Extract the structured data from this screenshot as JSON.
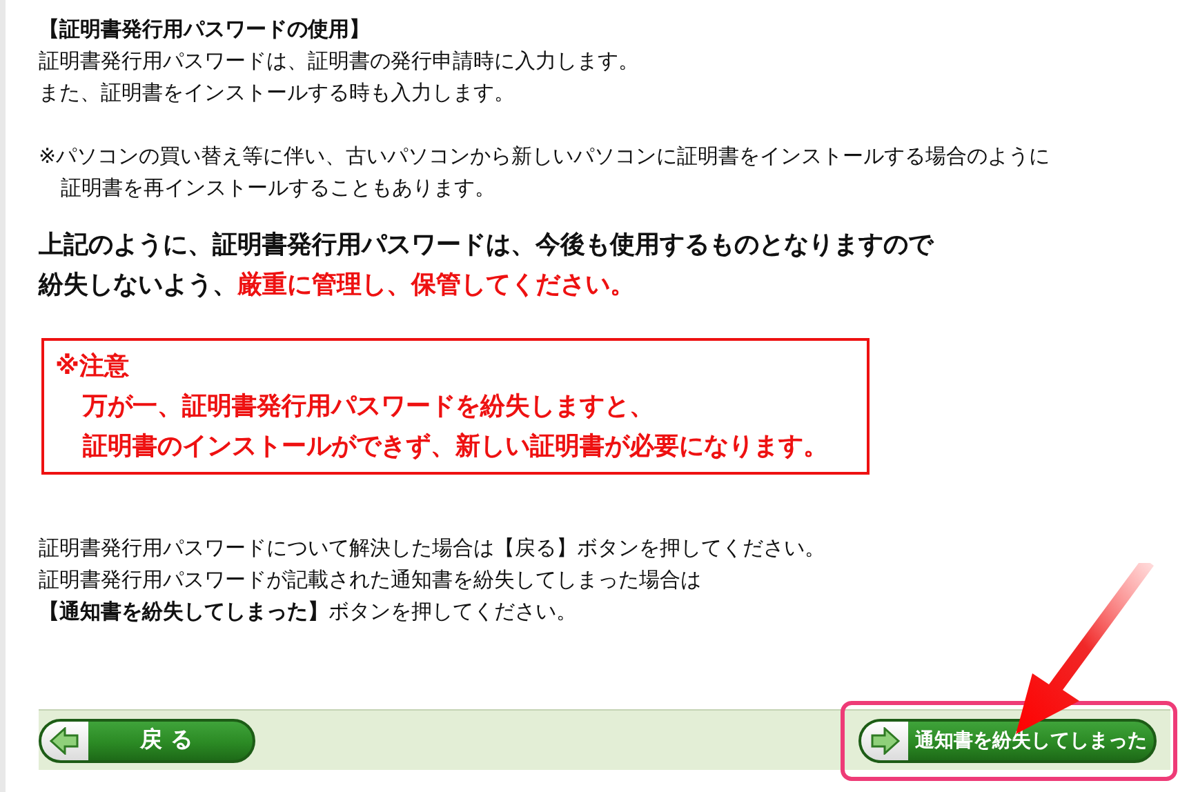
{
  "usage_section": {
    "heading": "【証明書発行用パスワードの使用】",
    "lines": [
      "証明書発行用パスワードは、証明書の発行申請時に入力します。",
      "また、証明書をインストールする時も入力します。"
    ],
    "note_lines": [
      "※パソコンの買い替え等に伴い、古いパソコンから新しいパソコンに証明書をインストールする場合のように",
      "証明書を再インストールすることもあります。"
    ]
  },
  "important": {
    "lines": [
      {
        "parts": [
          {
            "text": "上記のように、証明書発行用パスワードは、今後も使用するものとなりますので",
            "red": false
          }
        ]
      },
      {
        "parts": [
          {
            "text": "紛失しないよう、",
            "red": false
          },
          {
            "text": "厳重に管理し、保管してください。",
            "red": true
          }
        ]
      }
    ]
  },
  "caution": {
    "title": "※注意",
    "lines": [
      "万が一、証明書発行用パスワードを紛失しますと、",
      "証明書のインストールができず、新しい証明書が必要になります。"
    ]
  },
  "instructions": [
    "証明書発行用パスワードについて解決した場合は【戻る】ボタンを押してください。",
    "証明書発行用パスワードが記載された通知書を紛失してしまった場合は"
  ],
  "instruction_last": {
    "bold": "【通知書を紛失してしまった】",
    "rest": "ボタンを押してください。"
  },
  "buttons": [
    {
      "label": "戻る",
      "kind": "back",
      "highlighted": false
    },
    {
      "label": "通知書を紛失してしまった",
      "kind": "forward",
      "highlighted": true
    }
  ]
}
